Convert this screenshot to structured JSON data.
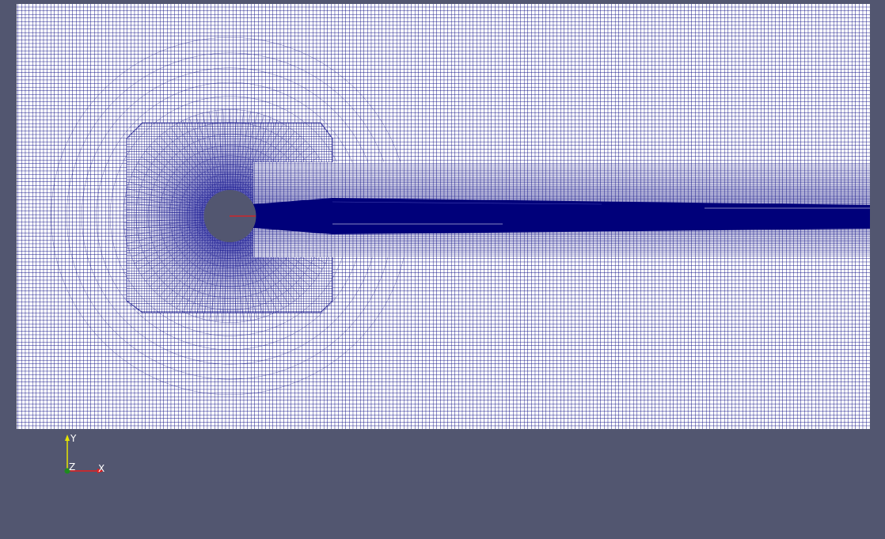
{
  "view": {
    "background": "#525670",
    "mesh_line_color": "#0c0c84",
    "mesh_fill": "#ffffff",
    "wake_color": "#00007a",
    "cylinder_color": "#525670",
    "axis_line_color": "#e61e1e"
  },
  "orientation_axes": {
    "y_label": "Y",
    "x_label": "X",
    "z_label": "Z",
    "y_color": "#e6e600",
    "x_color": "#e61e1e",
    "z_color": "#1e8c1e"
  }
}
